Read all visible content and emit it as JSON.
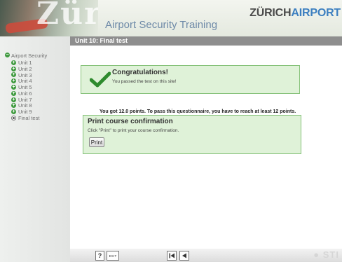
{
  "header": {
    "logo_text": "Zürich",
    "title": "Airport Security Training",
    "brand_part1": "ZÜRICH",
    "brand_part2": "AIRPORT"
  },
  "unit_bar": {
    "label": "Unit 10: Final test"
  },
  "sidebar": {
    "root": {
      "label": "Airport Security",
      "icon": "minus-circle-icon"
    },
    "items": [
      {
        "label": "Unit 1",
        "icon": "plus-circle-icon"
      },
      {
        "label": "Unit 2",
        "icon": "plus-circle-icon"
      },
      {
        "label": "Unit 3",
        "icon": "plus-circle-icon"
      },
      {
        "label": "Unit 4",
        "icon": "plus-circle-icon"
      },
      {
        "label": "Unit 5",
        "icon": "plus-circle-icon"
      },
      {
        "label": "Unit 6",
        "icon": "plus-circle-icon"
      },
      {
        "label": "Unit 7",
        "icon": "plus-circle-icon"
      },
      {
        "label": "Unit 8",
        "icon": "plus-circle-icon"
      },
      {
        "label": "Unit 9",
        "icon": "plus-circle-icon"
      },
      {
        "label": "Final test",
        "icon": "radio-selected-icon"
      }
    ]
  },
  "result": {
    "title": "Congratulations!",
    "message": "You passed the test on this site!",
    "icon": "checkmark-icon"
  },
  "score_text": "You got 12.0 points. To pass this questionnaire, you have to reach at least 12 points.",
  "print": {
    "title": "Print course confirmation",
    "instruction": "Click \"Print\" to print your course confirmation.",
    "button_label": "Print"
  },
  "footer": {
    "help_label": "?",
    "exit_label": "EXIT",
    "first_icon": "first-page-icon",
    "prev_icon": "previous-page-icon",
    "logo_text": "STI"
  },
  "colors": {
    "success_bg": "#dff2d8",
    "success_border": "#86c27a",
    "check_green": "#2e8b2e",
    "brand_blue": "#3c7fc0",
    "title_blue": "#6e8aa8",
    "unit_bar_gray": "#8e8e8e"
  }
}
